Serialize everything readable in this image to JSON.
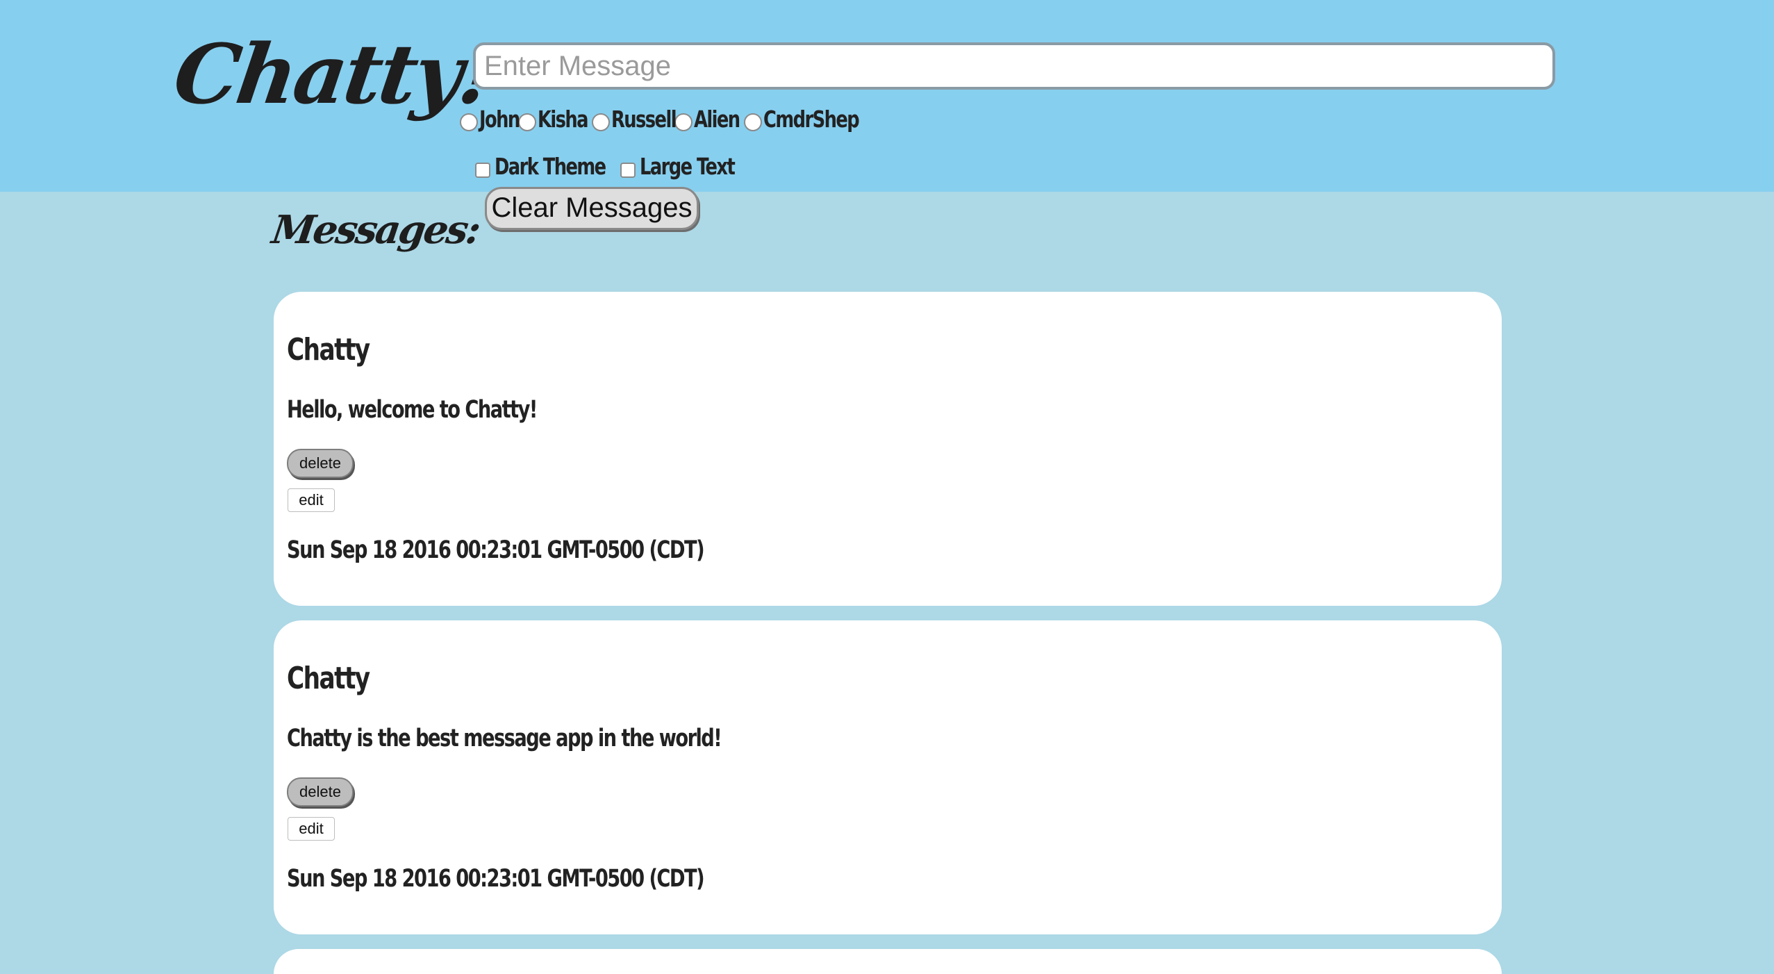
{
  "app": {
    "logo": "Chatty!"
  },
  "composer": {
    "placeholder": "Enter Message",
    "value": ""
  },
  "users": [
    {
      "label": "John",
      "selected": false
    },
    {
      "label": "Kisha",
      "selected": false
    },
    {
      "label": "Russell",
      "selected": false
    },
    {
      "label": "Alien",
      "selected": false
    },
    {
      "label": "CmdrShep",
      "selected": false
    }
  ],
  "options": [
    {
      "label": "Dark Theme",
      "checked": false
    },
    {
      "label": "Large Text",
      "checked": false
    }
  ],
  "clear_button": "Clear Messages",
  "messages_heading": "Messages:",
  "messages": [
    {
      "author": "Chatty",
      "text": "Hello, welcome to Chatty!",
      "delete_label": "delete",
      "edit_label": "edit",
      "timestamp": "Sun Sep 18 2016 00:23:01 GMT-0500 (CDT)"
    },
    {
      "author": "Chatty",
      "text": "Chatty is the best message app in the world!",
      "delete_label": "delete",
      "edit_label": "edit",
      "timestamp": "Sun Sep 18 2016 00:23:01 GMT-0500 (CDT)"
    },
    {
      "author": "",
      "text": "",
      "delete_label": "",
      "edit_label": "",
      "timestamp": ""
    }
  ],
  "colors": {
    "header_bg": "#87cfef",
    "page_bg": "#add8e6",
    "card_bg": "#ffffff"
  }
}
